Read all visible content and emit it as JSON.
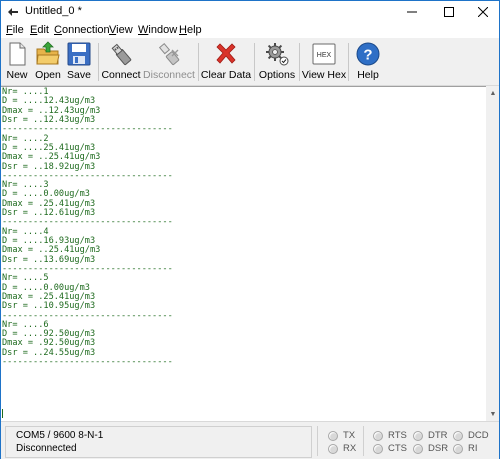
{
  "window": {
    "title": "Untitled_0 *"
  },
  "menu": {
    "file": {
      "underline": "F",
      "rest": "ile"
    },
    "edit": {
      "underline": "E",
      "rest": "dit"
    },
    "connection": {
      "underline": "C",
      "rest": "onnection"
    },
    "view": {
      "underline": "V",
      "rest": "iew"
    },
    "window": {
      "underline": "W",
      "rest": "indow"
    },
    "help": {
      "underline": "H",
      "rest": "elp"
    }
  },
  "toolbar": {
    "new": "New",
    "open": "Open",
    "save": "Save",
    "connect": "Connect",
    "disconnect": "Disconnect",
    "clear": "Clear Data",
    "options": "Options",
    "view_hex": "View Hex",
    "help": "Help",
    "hex_icon_text": "HEX"
  },
  "terminal": {
    "text": "Nr= ....1\nD = ....12.43ug/m3\nDmax = ..12.43ug/m3\nDsr = ..12.43ug/m3\n---------------------------------\nNr= ....2\nD = ....25.41ug/m3\nDmax = ..25.41ug/m3\nDsr = ..18.92ug/m3\n---------------------------------\nNr= ....3\nD = ....0.00ug/m3\nDmax = .25.41ug/m3\nDsr = ..12.61ug/m3\n---------------------------------\nNr= ....4\nD = ....16.93ug/m3\nDmax = ..25.41ug/m3\nDsr = ..13.69ug/m3\n---------------------------------\nNr= ....5\nD = ....0.00ug/m3\nDmax = .25.41ug/m3\nDsr = ..10.95ug/m3\n---------------------------------\nNr= ....6\nD = ....92.50ug/m3\nDmax = .92.50ug/m3\nDsr = ..24.55ug/m3\n---------------------------------"
  },
  "status": {
    "port_settings": "COM5 / 9600 8-N-1",
    "connection_state": "Disconnected",
    "tx": "TX",
    "rx": "RX",
    "rts": "RTS",
    "cts": "CTS",
    "dtr": "DTR",
    "dsr": "DSR",
    "dcd": "DCD",
    "ri": "RI"
  },
  "colors": {
    "terminal_text": "#1f6b1f",
    "window_border": "#1e73c8",
    "clear_icon": "#d9342b",
    "help_icon": "#2f6fc6"
  }
}
